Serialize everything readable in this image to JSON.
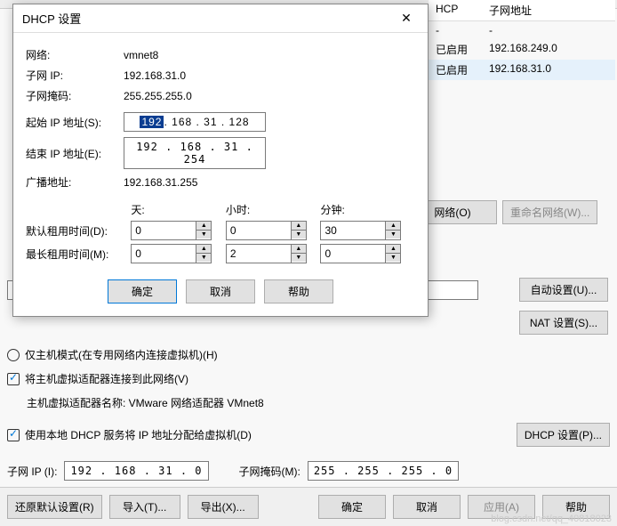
{
  "bg": {
    "col_dhcp": "HCP",
    "col_subnet": "子网地址",
    "rows": [
      {
        "dhcp": "-",
        "subnet": "-"
      },
      {
        "dhcp": "已启用",
        "subnet": "192.168.249.0"
      },
      {
        "dhcp": "已启用",
        "subnet": "192.168.31.0"
      }
    ],
    "add_net": "网络(O)",
    "rename_net": "重命名网络(W)...",
    "auto_set": "自动设置(U)...",
    "nat_set": "NAT 设置(S)...",
    "radio_hostonly": "仅主机模式(在专用网络内连接虚拟机)(H)",
    "chk_host_adapter": "将主机虚拟适配器连接到此网络(V)",
    "host_adapter_name_lbl": "主机虚拟适配器名称: VMware 网络适配器 VMnet8",
    "chk_dhcp": "使用本地 DHCP 服务将 IP 地址分配给虚拟机(D)",
    "dhcp_settings_btn": "DHCP 设置(P)...",
    "subnet_ip_lbl": "子网 IP (I):",
    "subnet_ip": "192 . 168 . 31 . 0",
    "subnet_mask_lbl": "子网掩码(M):",
    "subnet_mask": "255 . 255 . 255 . 0",
    "restore": "还原默认设置(R)",
    "import": "导入(T)...",
    "export": "导出(X)...",
    "ok": "确定",
    "cancel": "取消",
    "apply": "应用(A)",
    "help": "帮助"
  },
  "dlg": {
    "title": "DHCP 设置",
    "net_lbl": "网络:",
    "net_val": "vmnet8",
    "subip_lbl": "子网 IP:",
    "subip_val": "192.168.31.0",
    "mask_lbl": "子网掩码:",
    "mask_val": "255.255.255.0",
    "start_lbl": "起始 IP 地址(S):",
    "start_oct1": "192",
    "start_rest": ". 168 . 31 . 128",
    "end_lbl": "结束 IP 地址(E):",
    "end_val": "192 . 168 . 31 . 254",
    "bcast_lbl": "广播地址:",
    "bcast_val": "192.168.31.255",
    "day": "天:",
    "hour": "小时:",
    "minute": "分钟:",
    "def_lease_lbl": "默认租用时间(D):",
    "max_lease_lbl": "最长租用时间(M):",
    "def": {
      "d": "0",
      "h": "0",
      "m": "30"
    },
    "max": {
      "d": "0",
      "h": "2",
      "m": "0"
    },
    "ok": "确定",
    "cancel": "取消",
    "help": "帮助"
  },
  "watermark": "blog.csdn.net/qq_40818023"
}
